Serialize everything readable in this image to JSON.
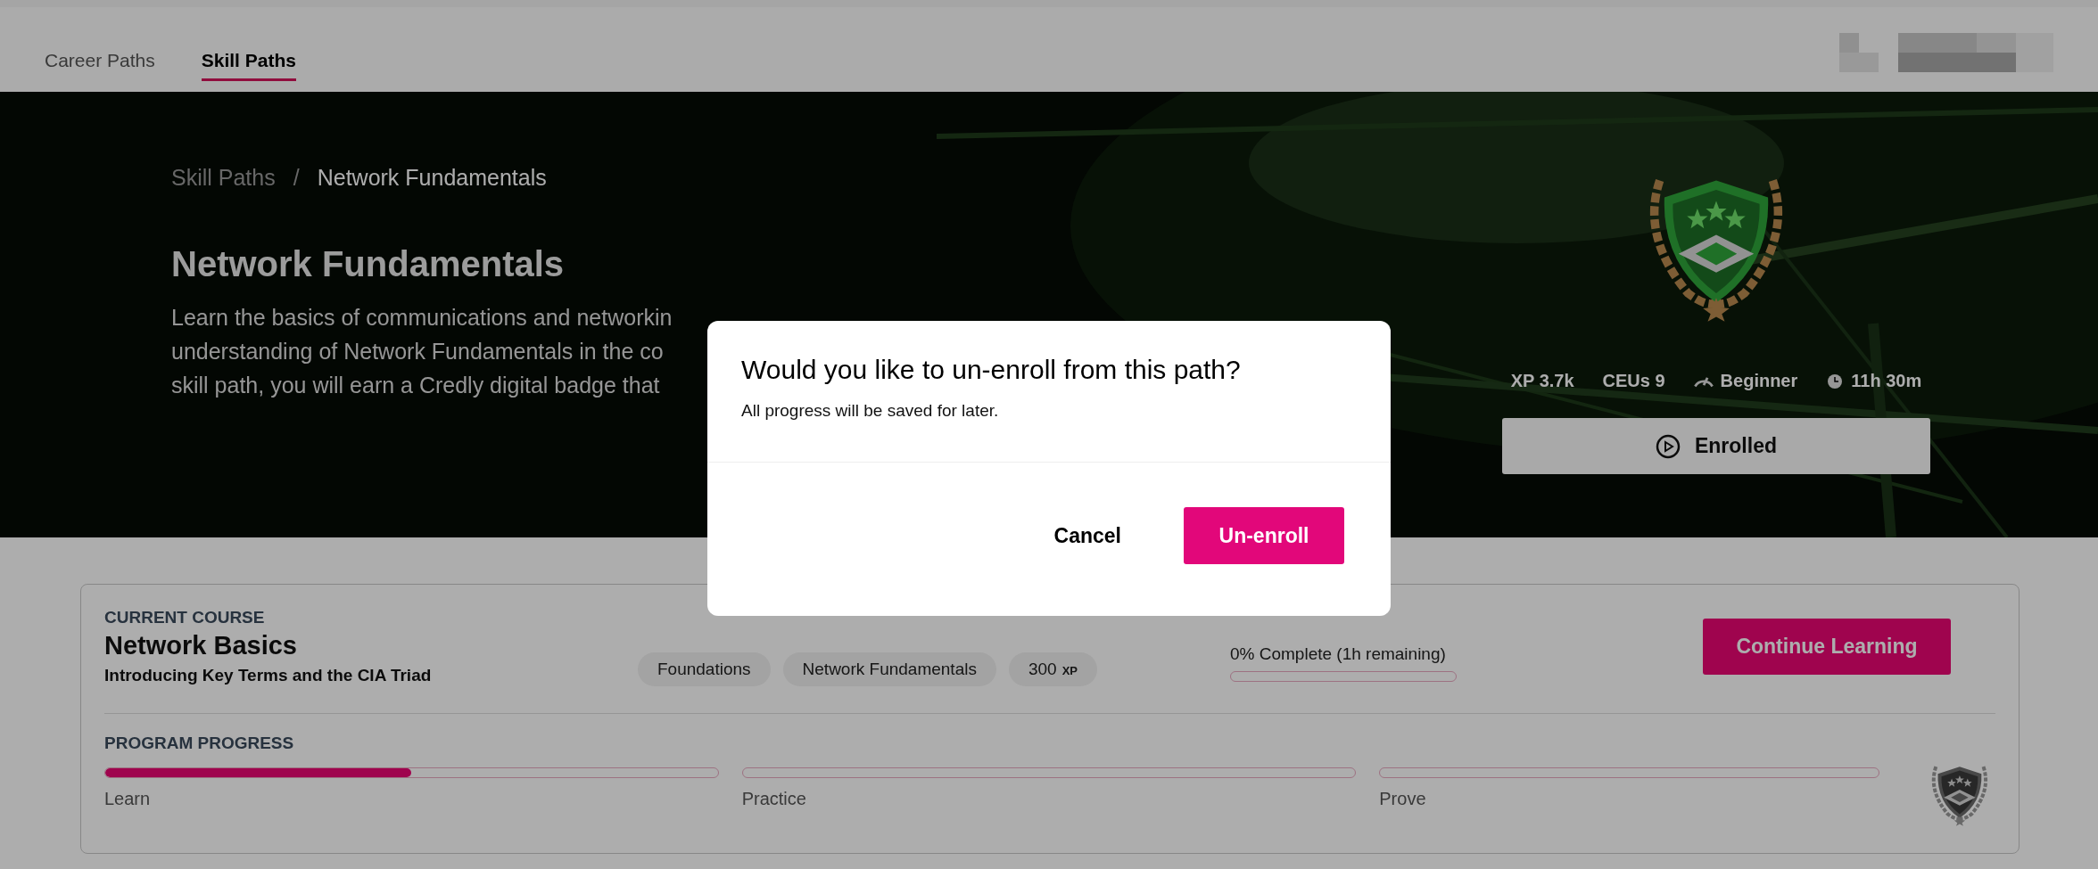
{
  "tabs": [
    {
      "label": "Career Paths",
      "selected": false
    },
    {
      "label": "Skill Paths",
      "selected": true
    }
  ],
  "hero": {
    "breadcrumb": [
      "Skill Paths",
      "Network Fundamentals"
    ],
    "breadcrumb_separator": "/",
    "title": "Network Fundamentals",
    "description_lines": [
      "Learn the basics of communications and networkin",
      "understanding of Network Fundamentals in the co",
      "skill path, you will earn a Credly digital badge that"
    ],
    "stats": [
      {
        "kind": "text",
        "label": "XP 3.7k"
      },
      {
        "kind": "text",
        "label": "CEUs 9"
      },
      {
        "kind": "level",
        "label": "Beginner"
      },
      {
        "kind": "time",
        "label": "11h 30m"
      }
    ],
    "enroll_button": "Enrolled"
  },
  "current_course": {
    "heading": "CURRENT COURSE",
    "title": "Network Basics",
    "subtitle": "Introducing Key Terms and the CIA Triad",
    "tags": [
      {
        "label": "Foundations"
      },
      {
        "label": "Network Fundamentals"
      },
      {
        "label": "300",
        "unit": "XP"
      }
    ],
    "progress_label": "0% Complete (1h remaining)",
    "level": 0,
    "button": "Continue Learning"
  },
  "program_progress": {
    "heading": "PROGRAM PROGRESS",
    "stages": [
      {
        "label": "Learn",
        "level": 0.5
      },
      {
        "label": "Practice",
        "level": 0
      },
      {
        "label": "Prove",
        "level": 0
      }
    ]
  },
  "dialog": {
    "title": "Would you like to un-enroll from this path?",
    "message": "All progress will be saved for later.",
    "buttons": [
      {
        "label": "Cancel",
        "kind": "secondary"
      },
      {
        "label": "Un-enroll",
        "kind": "primary"
      }
    ]
  }
}
